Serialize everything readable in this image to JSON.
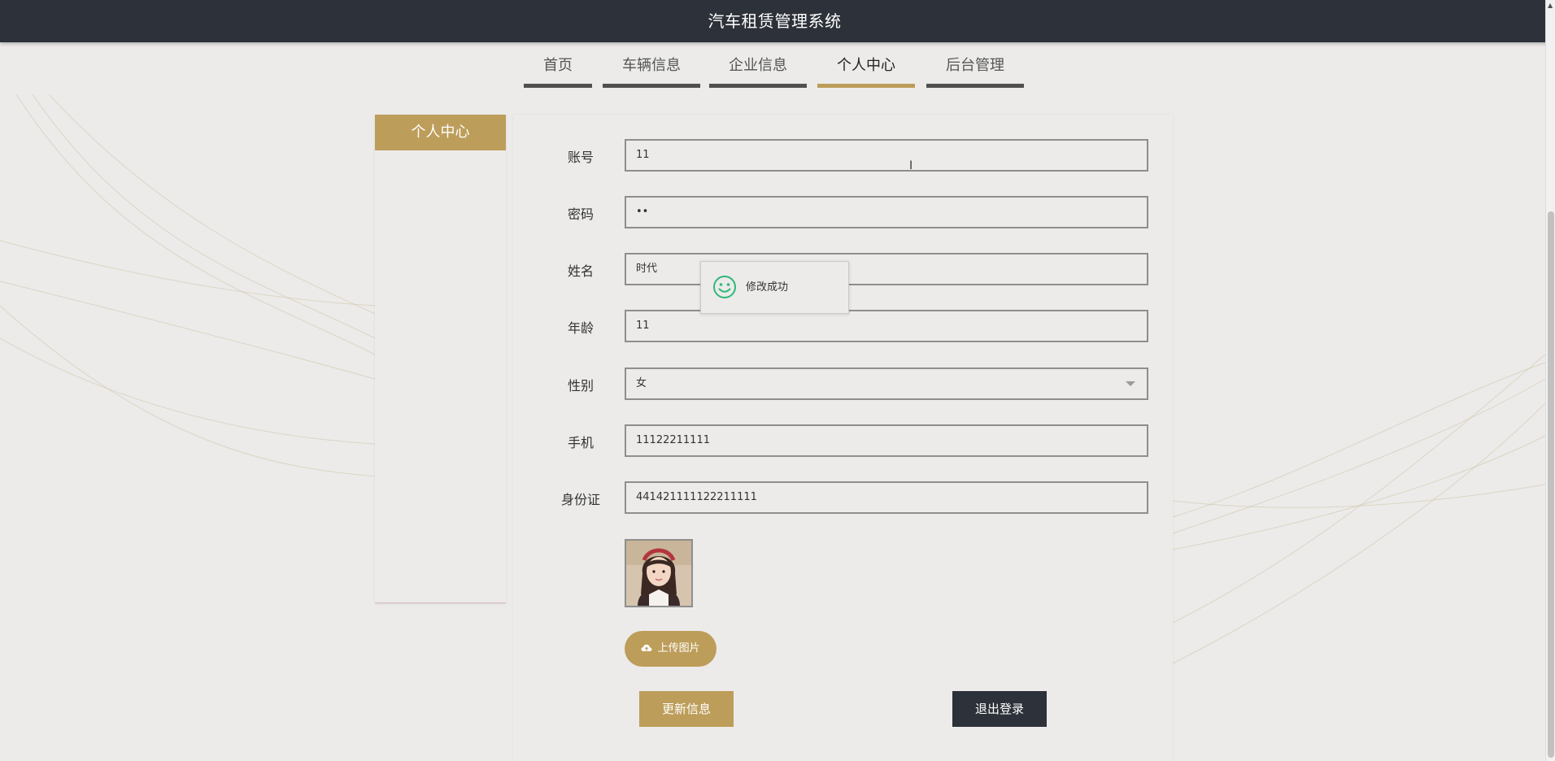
{
  "app": {
    "title": "汽车租赁管理系统"
  },
  "nav": {
    "items": [
      {
        "label": "首页"
      },
      {
        "label": "车辆信息"
      },
      {
        "label": "企业信息"
      },
      {
        "label": "个人中心"
      },
      {
        "label": "后台管理"
      }
    ],
    "active": "个人中心"
  },
  "sidebar": {
    "title": "个人中心"
  },
  "form": {
    "fields": [
      {
        "label": "账号",
        "value": "11"
      },
      {
        "label": "密码",
        "value": "••"
      },
      {
        "label": "姓名",
        "value": "时代"
      },
      {
        "label": "年龄",
        "value": "11"
      },
      {
        "label": "性别",
        "value": "女"
      },
      {
        "label": "手机",
        "value": "11122211111"
      },
      {
        "label": "身份证",
        "value": "441421111122211111"
      }
    ],
    "upload_label": "上传图片",
    "update_label": "更新信息",
    "logout_label": "退出登录"
  },
  "toast": {
    "message": "修改成功"
  },
  "colors": {
    "accent": "#bd9d5a",
    "dark": "#2d3139",
    "background": "#ecebea",
    "success": "#2fb87a"
  },
  "icons": {
    "toast": "smile-icon",
    "upload": "cloud-upload-icon",
    "select": "chevron-down-icon"
  }
}
